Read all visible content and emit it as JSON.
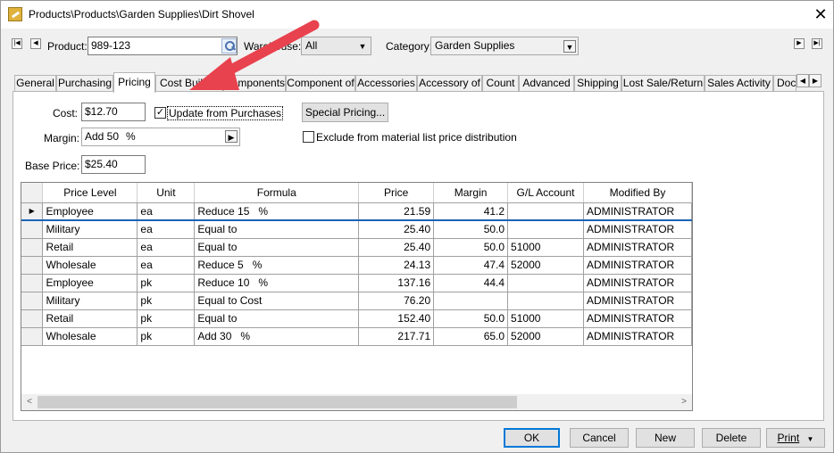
{
  "window": {
    "title": "Products\\Products\\Garden Supplies\\Dirt Shovel",
    "close_glyph": "✕"
  },
  "header": {
    "product_label": "Product:",
    "product_value": "989-123",
    "warehouse_label": "Warehouse:",
    "warehouse_value": "All",
    "category_label": "Category:",
    "category_value": "Garden Supplies"
  },
  "tabs": [
    {
      "label": "General"
    },
    {
      "label": "Purchasing"
    },
    {
      "label": "Pricing",
      "active": true
    },
    {
      "label": "Cost Buildout"
    },
    {
      "label": "Components"
    },
    {
      "label": "Component of"
    },
    {
      "label": "Accessories"
    },
    {
      "label": "Accessory of"
    },
    {
      "label": "Count"
    },
    {
      "label": "Advanced"
    },
    {
      "label": "Shipping"
    },
    {
      "label": "Lost Sale/Return"
    },
    {
      "label": "Sales Activity"
    },
    {
      "label": "Documents"
    }
  ],
  "pricing": {
    "cost_label": "Cost:",
    "cost_value": "$12.70",
    "update_from_purchases_label": "Update from Purchases",
    "update_from_purchases_checked": true,
    "special_pricing_button": "Special Pricing...",
    "margin_label": "Margin:",
    "margin_value": "Add 50",
    "margin_unit": "%",
    "exclude_label": "Exclude from material list price distribution",
    "exclude_checked": false,
    "base_price_label": "Base Price:",
    "base_price_value": "$25.40"
  },
  "grid": {
    "columns": [
      "Price Level",
      "Unit",
      "Formula",
      "Price",
      "Margin",
      "G/L Account",
      "Modified By"
    ],
    "rows": [
      {
        "level": "Employee",
        "unit": "ea",
        "formula": "Reduce 15",
        "pct": "%",
        "price": "21.59",
        "margin": "41.2",
        "gl": "",
        "modified_by": "ADMINISTRATOR",
        "current": true
      },
      {
        "level": "Military",
        "unit": "ea",
        "formula": "Equal to",
        "pct": "",
        "price": "25.40",
        "margin": "50.0",
        "gl": "",
        "modified_by": "ADMINISTRATOR"
      },
      {
        "level": "Retail",
        "unit": "ea",
        "formula": "Equal to",
        "pct": "",
        "price": "25.40",
        "margin": "50.0",
        "gl": "51000",
        "modified_by": "ADMINISTRATOR"
      },
      {
        "level": "Wholesale",
        "unit": "ea",
        "formula": "Reduce 5",
        "pct": "%",
        "price": "24.13",
        "margin": "47.4",
        "gl": "52000",
        "modified_by": "ADMINISTRATOR"
      },
      {
        "level": "Employee",
        "unit": "pk",
        "formula": "Reduce 10",
        "pct": "%",
        "price": "137.16",
        "margin": "44.4",
        "gl": "",
        "modified_by": "ADMINISTRATOR"
      },
      {
        "level": "Military",
        "unit": "pk",
        "formula": "Equal to Cost",
        "pct": "",
        "price": "76.20",
        "margin": "",
        "gl": "",
        "modified_by": "ADMINISTRATOR"
      },
      {
        "level": "Retail",
        "unit": "pk",
        "formula": "Equal to",
        "pct": "",
        "price": "152.40",
        "margin": "50.0",
        "gl": "51000",
        "modified_by": "ADMINISTRATOR"
      },
      {
        "level": "Wholesale",
        "unit": "pk",
        "formula": "Add 30",
        "pct": "%",
        "price": "217.71",
        "margin": "65.0",
        "gl": "52000",
        "modified_by": "ADMINISTRATOR"
      }
    ],
    "current_row_glyph": "▶"
  },
  "footer": {
    "ok": "OK",
    "cancel": "Cancel",
    "new": "New",
    "delete": "Delete",
    "print": "Print",
    "print_arrow": "▼"
  },
  "icons": {
    "first": "|◀",
    "prev": "◀",
    "next": "▶",
    "last": "▶|",
    "dropdown": "▼",
    "scroll_left": "<",
    "scroll_right": ">",
    "tab_left": "◀",
    "tab_right": "▶"
  },
  "colors": {
    "accent": "#0078d7",
    "annotation_arrow": "#e8424e",
    "row_highlight_border": "#1a64b4"
  }
}
